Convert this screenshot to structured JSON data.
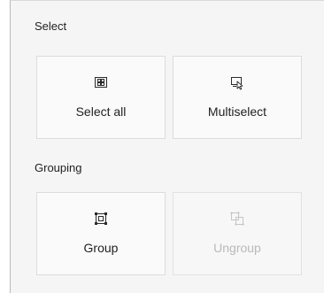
{
  "select_section": {
    "label": "Select",
    "buttons": [
      {
        "label": "Select all",
        "icon": "select-all-icon",
        "enabled": true
      },
      {
        "label": "Multiselect",
        "icon": "multiselect-icon",
        "enabled": true
      }
    ]
  },
  "grouping_section": {
    "label": "Grouping",
    "buttons": [
      {
        "label": "Group",
        "icon": "group-icon",
        "enabled": true
      },
      {
        "label": "Ungroup",
        "icon": "ungroup-icon",
        "enabled": false
      }
    ]
  },
  "colors": {
    "icon": "#2b2b2b",
    "disabled_icon": "#c6c6c6",
    "disabled_text": "#b9b9b9"
  }
}
